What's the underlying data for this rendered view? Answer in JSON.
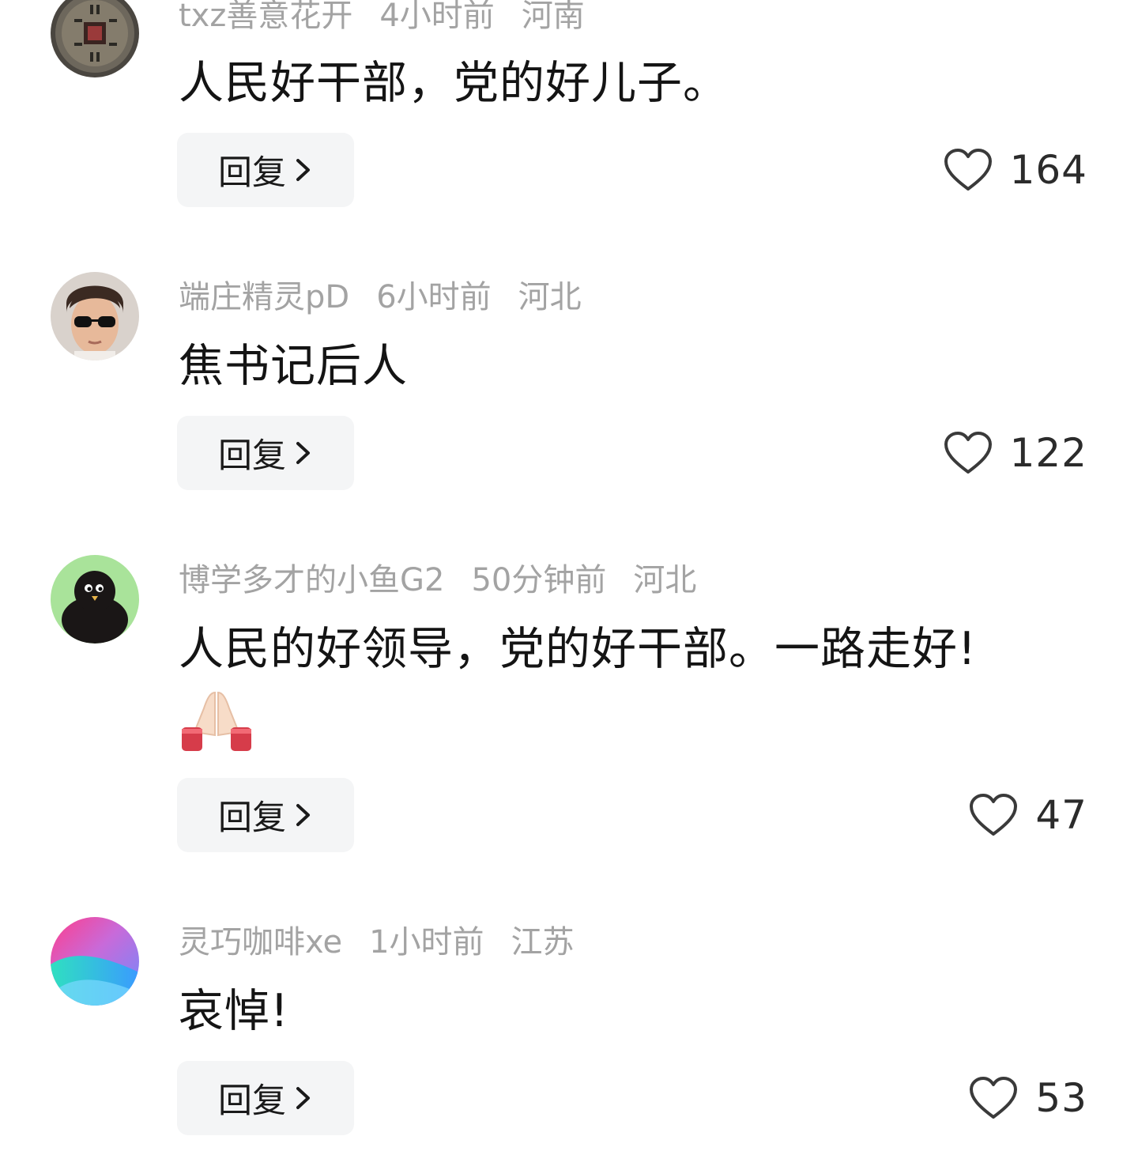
{
  "comments": [
    {
      "username": "txz善意花开",
      "time": "4小时前",
      "location": "河南",
      "text": "人民好干部，党的好儿子。",
      "reply_label": "回复",
      "likes": "164",
      "avatar": "coin-avatar"
    },
    {
      "username": "端庄精灵pD",
      "time": "6小时前",
      "location": "河北",
      "text": "焦书记后人",
      "reply_label": "回复",
      "likes": "122",
      "avatar": "sunglasses-man-avatar"
    },
    {
      "username": "博学多才的小鱼G2",
      "time": "50分钟前",
      "location": "河北",
      "text": "人民的好领导，党的好干部。一路走好!",
      "emoji": "praying-hands-emoji",
      "reply_label": "回复",
      "likes": "47",
      "avatar": "black-bird-avatar"
    },
    {
      "username": "灵巧咖啡xe",
      "time": "1小时前",
      "location": "江苏",
      "text": "哀悼!",
      "reply_label": "回复",
      "likes": "53",
      "avatar": "gradient-avatar"
    }
  ],
  "colors": {
    "meta_text": "#a3a3a3",
    "body_text": "#141414",
    "reply_bg": "#f4f5f6"
  }
}
